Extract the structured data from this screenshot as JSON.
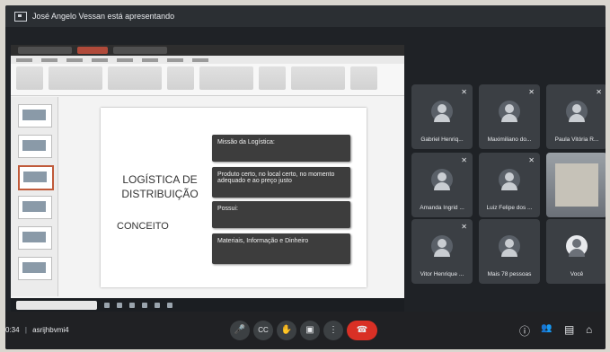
{
  "banner": {
    "text": "José Angelo Vessan está apresentando"
  },
  "slide": {
    "title_line1": "LOGÍSTICA DE",
    "title_line2": "DISTRIBUIÇÃO",
    "concept": "CONCEITO",
    "boxes": [
      "Missão da Logística:",
      "Produto certo, no local certo, no momento adequado e ao preço justo",
      "Possui:",
      "Materiais, Informação e Dinheiro"
    ]
  },
  "participants": [
    {
      "name": "Gabriel Henriq...",
      "muted": true
    },
    {
      "name": "Maximiliano do...",
      "muted": true
    },
    {
      "name": "Paula Vitória R...",
      "muted": true
    },
    {
      "name": "Amanda Ingrid ...",
      "muted": true
    },
    {
      "name": "Luiz Felipe dos ...",
      "muted": true
    },
    {
      "name": "",
      "muted": false,
      "video": true
    },
    {
      "name": "Vitor Henrique ...",
      "muted": true
    },
    {
      "name": "Mais 78 pessoas",
      "muted": false
    },
    {
      "name": "Você",
      "muted": false
    }
  ],
  "meeting": {
    "time": "0:34",
    "code": "asrijhbvmi4"
  },
  "controls": {
    "mic_icon": "🎤",
    "cc_icon": "CC",
    "hand_icon": "✋",
    "present_icon": "▣",
    "more_icon": "⋮",
    "end_icon": "☎",
    "info_icon": "ⓘ",
    "people_icon": "👥",
    "chat_icon": "▤",
    "activities_icon": "⌂"
  },
  "colors": {
    "accent_red": "#d93025",
    "bar": "#202124"
  }
}
